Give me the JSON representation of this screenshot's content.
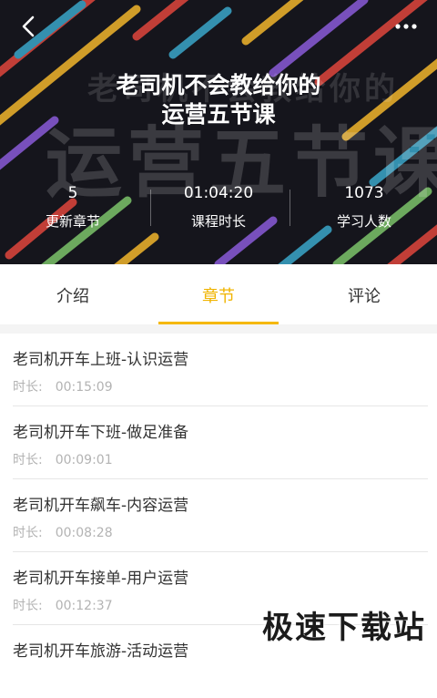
{
  "header": {
    "bg_text_small": "老司机不会教给你的",
    "bg_text_big": "运营五节课",
    "title_line1": "老司机不会教给你的",
    "title_line2": "运营五节课",
    "back_icon": "chevron-left-icon",
    "more_icon": "more-horizontal-icon"
  },
  "stats": [
    {
      "value": "5",
      "label": "更新章节"
    },
    {
      "value": "01:04:20",
      "label": "课程时长"
    },
    {
      "value": "1073",
      "label": "学习人数"
    }
  ],
  "tabs": [
    {
      "label": "介绍",
      "active": false
    },
    {
      "label": "章节",
      "active": true
    },
    {
      "label": "评论",
      "active": false
    }
  ],
  "chapter_meta_label": "时长:",
  "chapters": [
    {
      "title": "老司机开车上班-认识运营",
      "duration": "00:15:09"
    },
    {
      "title": "老司机开车下班-做足准备",
      "duration": "00:09:01"
    },
    {
      "title": "老司机开车飙车-内容运营",
      "duration": "00:08:28"
    },
    {
      "title": "老司机开车接单-用户运营",
      "duration": "00:12:37"
    },
    {
      "title": "老司机开车旅游-活动运营",
      "duration": ""
    }
  ],
  "watermark": "极速下载站",
  "colors": {
    "accent": "#f5b800",
    "hero_bg": "#15151c",
    "stripe_colors": [
      "#e0463c",
      "#f1b52c",
      "#3aa6c9",
      "#8a5bd8",
      "#7cc36a"
    ]
  }
}
